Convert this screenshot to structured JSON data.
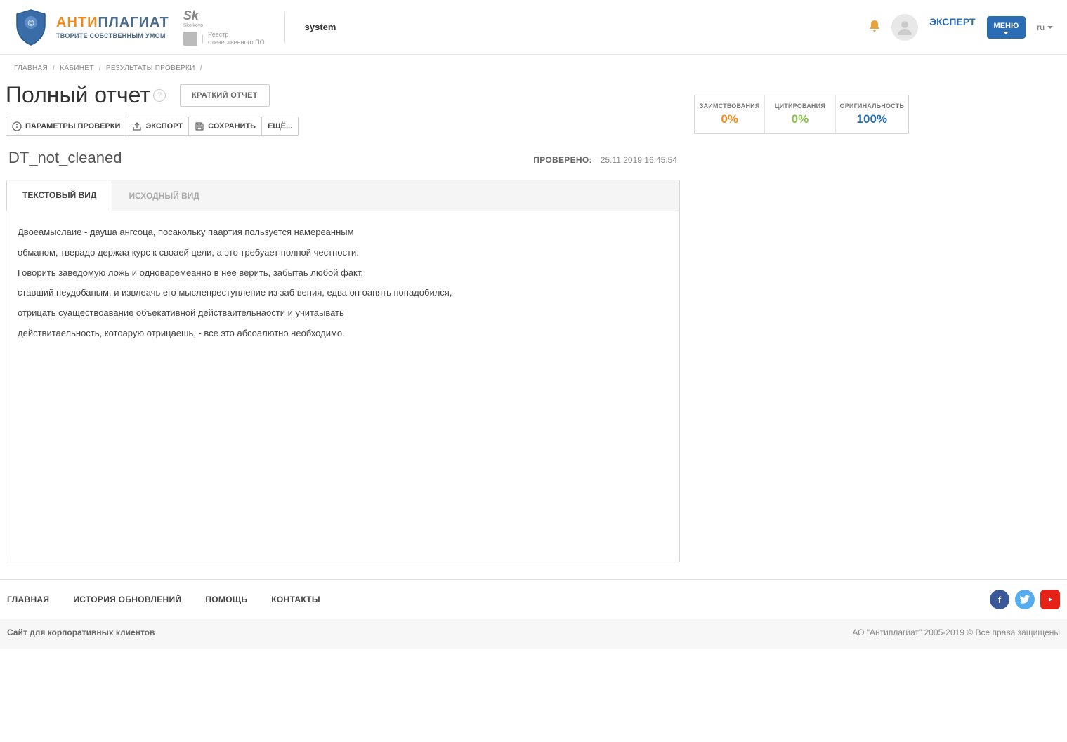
{
  "header": {
    "logo": {
      "anti": "АНТИ",
      "plag": "ПЛАГИАТ",
      "sub": "ТВОРИТЕ СОБСТВЕННЫМ УМОМ"
    },
    "partner_sk": "Sk",
    "partner_sk_sub": "Skolkovo",
    "partner_reg_line1": "Реестр",
    "partner_reg_line2": "отечественного ПО",
    "system": "system",
    "expert": "ЭКСПЕРТ",
    "menu_btn": "МЕНЮ",
    "lang": "ru"
  },
  "breadcrumb": {
    "items": [
      "ГЛАВНАЯ",
      "КАБИНЕТ",
      "РЕЗУЛЬТАТЫ ПРОВЕРКИ"
    ]
  },
  "title": "Полный отчет",
  "brief_btn": "КРАТКИЙ ОТЧЕТ",
  "toolbar": {
    "params": "ПАРАМЕТРЫ ПРОВЕРКИ",
    "export": "ЭКСПОРТ",
    "save": "СОХРАНИТЬ",
    "more": "ЕЩЁ..."
  },
  "doc": {
    "name": "DT_not_cleaned",
    "checked_label": "ПРОВЕРЕНО:",
    "checked_date": "25.11.2019 16:45:54"
  },
  "tabs": {
    "text_view": "ТЕКСТОВЫЙ ВИД",
    "source_view": "ИСХОДНЫЙ ВИД"
  },
  "text_lines": [
    "Двоеамыслаие - дауша ангсоца, посакольку паартия пользуется намереанным",
    "обманом, тверадо держаа курс к своаей цели, а это требуает полной честности.",
    "Говорить заведомую ложь и одноваремеанно в неё верить, забытаь любой факт,",
    "ставший неудобаным, и извлеачь его мыслепреступление из заб вения, едва он оапять понадобился,",
    "отрицать суаществоавание объекативной действаительнаости и учитаывать",
    "действитаельность, котоарую отрицаешь, - все это абсоалютно необходимо."
  ],
  "stats": {
    "borrow_label": "ЗАИМСТВОВАНИЯ",
    "borrow_val": "0%",
    "cite_label": "ЦИТИРОВАНИЯ",
    "cite_val": "0%",
    "orig_label": "ОРИГИНАЛЬНОСТЬ",
    "orig_val": "100%"
  },
  "footer": {
    "nav": [
      "ГЛАВНАЯ",
      "ИСТОРИЯ ОБНОВЛЕНИЙ",
      "ПОМОЩЬ",
      "КОНТАКТЫ"
    ],
    "corp": "Сайт для корпоративных клиентов",
    "copyright": "АО \"Антиплагиат\" 2005-2019 © Все права защищены"
  }
}
